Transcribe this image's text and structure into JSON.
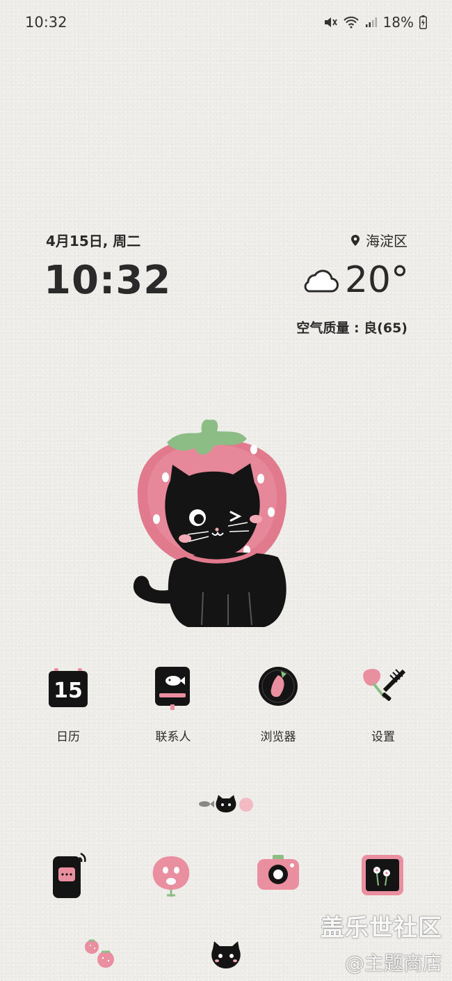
{
  "status_bar": {
    "time": "10:32",
    "battery": "18%"
  },
  "widget": {
    "date": "4月15日, 周二",
    "clock": "10:32",
    "location": "海淀区",
    "temperature": "20°",
    "air_quality": "空气质量 : 良(65)",
    "weather_icon": "cloud-icon"
  },
  "apps": [
    {
      "label": "日历",
      "icon": "calendar-icon",
      "day": "15"
    },
    {
      "label": "联系人",
      "icon": "contacts-icon"
    },
    {
      "label": "浏览器",
      "icon": "browser-icon"
    },
    {
      "label": "设置",
      "icon": "settings-icon"
    }
  ],
  "dock": [
    {
      "icon": "phone-icon"
    },
    {
      "icon": "messages-icon"
    },
    {
      "icon": "camera-icon"
    },
    {
      "icon": "gallery-icon"
    }
  ],
  "watermark": {
    "line1": "盖乐世社区",
    "line2": "@主题商店"
  },
  "colors": {
    "pink": "#e8748a",
    "light_pink": "#f3a9b6",
    "green": "#7fb27a",
    "black": "#141414"
  }
}
